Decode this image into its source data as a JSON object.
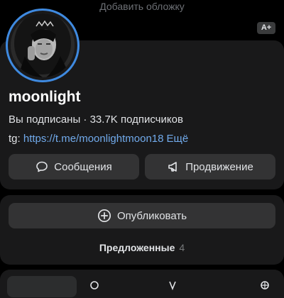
{
  "cover": {
    "hint": "Добавить обложку"
  },
  "badge": {
    "label": "A+"
  },
  "profile": {
    "name": "moonlight",
    "subscribed": "Вы подписаны",
    "separator": " · ",
    "followers": "33.7K подписчиков",
    "link_prefix": "tg: ",
    "link_url": "https://t.me/moonlightmoon18",
    "more": "Ещё"
  },
  "actions": {
    "messages_label": "Сообщения",
    "promote_label": "Продвижение"
  },
  "publish": {
    "label": "Опубликовать",
    "suggested_label": "Предложенные",
    "suggested_count": "4"
  },
  "colors": {
    "background": "#000000",
    "card": "#19191a",
    "button": "#333334",
    "accent_ring": "#3f8ae0",
    "link": "#71aaeb"
  },
  "icons": [
    "chat-bubble-icon",
    "megaphone-icon",
    "plus-circle-icon"
  ]
}
